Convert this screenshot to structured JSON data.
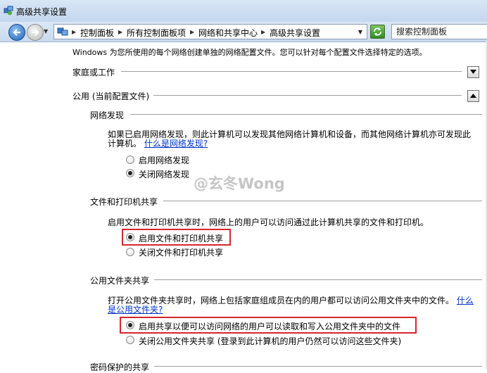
{
  "window": {
    "title": "高级共享设置"
  },
  "address": {
    "crumbs": [
      "控制面板",
      "所有控制面板项",
      "网络和共享中心",
      "高级共享设置"
    ],
    "search_placeholder": "搜索控制面板"
  },
  "intro": "Windows 为您所使用的每个网络创建单独的网络配置文件。您可以针对每个配置文件选择特定的选项。",
  "profiles": {
    "home_work": {
      "label": "家庭或工作",
      "expanded": false
    },
    "public": {
      "label": "公用 (当前配置文件)",
      "expanded": true
    }
  },
  "network_discovery": {
    "heading": "网络发现",
    "desc_line1": "如果已启用网络发现，则此计算机可以发现其他网络计算机和设备，而其他网络计算机亦可发现此",
    "desc_line2": "计算机。",
    "link": "什么是网络发现?",
    "options": [
      {
        "label": "启用网络发现",
        "checked": false
      },
      {
        "label": "关闭网络发现",
        "checked": true
      }
    ]
  },
  "file_printer": {
    "heading": "文件和打印机共享",
    "desc": "启用文件和打印机共享时，网络上的用户可以访问通过此计算机共享的文件和打印机。",
    "options": [
      {
        "label": "启用文件和打印机共享",
        "checked": true
      },
      {
        "label": "关闭文件和打印机共享",
        "checked": false
      }
    ]
  },
  "public_folder": {
    "heading": "公用文件夹共享",
    "desc_line1": "打开公用文件夹共享时，网络上包括家庭组成员在内的用户都可以访问公用文件夹中的文件。",
    "link_part1": "什么",
    "link_part2": "是公用文件夹?",
    "options": [
      {
        "label": "启用共享以便可以访问网络的用户可以读取和写入公用文件夹中的文件",
        "checked": true
      },
      {
        "label": "关闭公用文件夹共享 (登录到此计算机的用户仍然可以访问这些文件夹)",
        "checked": false
      }
    ]
  },
  "password": {
    "heading": "密码保护的共享"
  },
  "watermark": "@玄冬Wong",
  "colors": {
    "highlight": "#d7262d",
    "link": "#0033cc"
  }
}
